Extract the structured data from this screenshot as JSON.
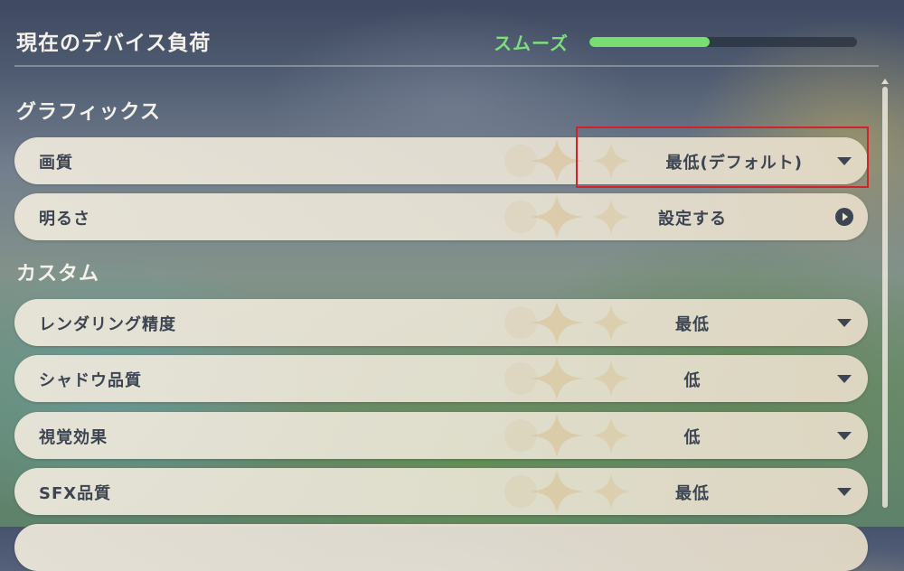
{
  "header": {
    "title": "現在のデバイス負荷",
    "load_status": "スムーズ",
    "load_level": 0.45,
    "load_color": "#78de72"
  },
  "sections": {
    "graphics": {
      "title": "グラフィックス"
    },
    "custom": {
      "title": "カスタム"
    }
  },
  "rows": {
    "quality": {
      "label": "画質",
      "value": "最低(デフォルト)",
      "icon": "dropdown-triangle-icon"
    },
    "brightness": {
      "label": "明るさ",
      "value": "設定する",
      "icon": "arrow-circle-right-icon"
    },
    "render_precision": {
      "label": "レンダリング精度",
      "value": "最低",
      "icon": "dropdown-triangle-icon"
    },
    "shadow_quality": {
      "label": "シャドウ品質",
      "value": "低",
      "icon": "dropdown-triangle-icon"
    },
    "visual_effects": {
      "label": "視覚効果",
      "value": "低",
      "icon": "dropdown-triangle-icon"
    },
    "sfx_quality": {
      "label": "SFX品質",
      "value": "最低",
      "icon": "dropdown-triangle-icon"
    }
  },
  "colors": {
    "highlight": "#d2232a",
    "row_text": "#3d4452",
    "heading_text": "#f4f1ea"
  }
}
